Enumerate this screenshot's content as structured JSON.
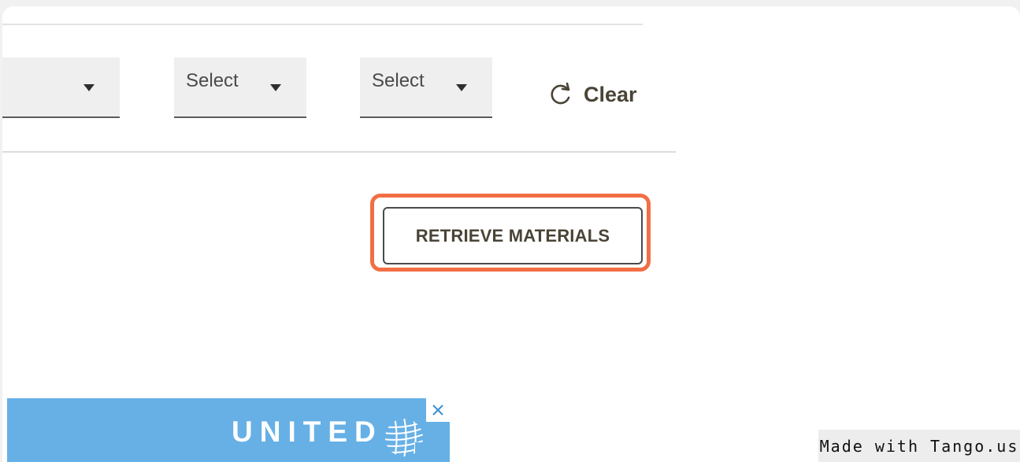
{
  "filters": {
    "select_1": {
      "value": ""
    },
    "select_2": {
      "value": "Select"
    },
    "select_3": {
      "value": "Select"
    },
    "clear_label": "Clear"
  },
  "actions": {
    "retrieve_label": "RETRIEVE MATERIALS"
  },
  "ad": {
    "brand": "UNITED",
    "background": "#66b0e6",
    "close_icon": "close-icon"
  },
  "watermark": {
    "text": "Made with Tango.us"
  },
  "colors": {
    "highlight": "#f26f45",
    "text_dark": "#4a4437"
  }
}
